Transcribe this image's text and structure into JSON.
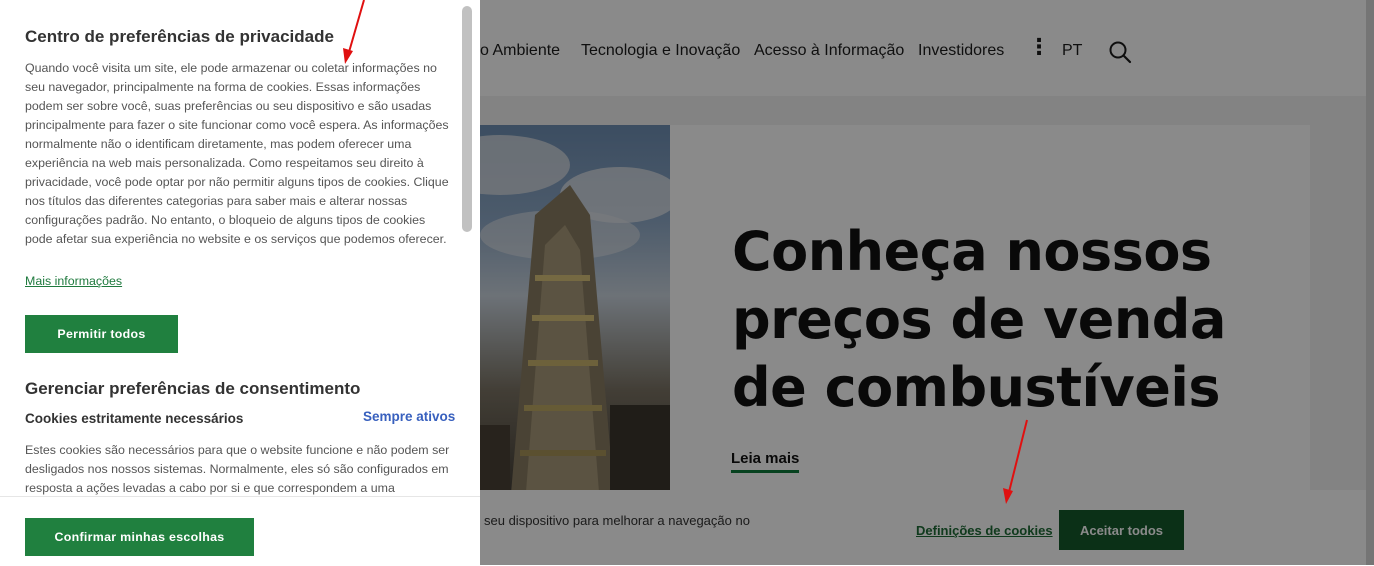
{
  "site": {
    "nav": {
      "items": [
        "o Ambiente",
        "Tecnologia e Inovação",
        "Acesso à Informação",
        "Investidores"
      ],
      "more_icon": "vertical-dots-icon",
      "language": "PT",
      "search_icon": "search-icon"
    },
    "hero": {
      "title": "Conheça nossos preços de venda de combustíveis",
      "link": "Leia mais"
    },
    "cookie_banner": {
      "text": "seu dispositivo para melhorar a navegação no",
      "settings_link": "Definições de cookies",
      "accept_all": "Aceitar todos"
    }
  },
  "privacy_panel": {
    "title": "Centro de preferências de privacidade",
    "description": "Quando você visita um site, ele pode armazenar ou coletar informações no seu navegador, principalmente na forma de cookies. Essas informações podem ser sobre você, suas preferências ou seu dispositivo e são usadas principalmente para fazer o site funcionar como você espera. As informações normalmente não o identificam diretamente, mas podem oferecer uma experiência na web mais personalizada. Como respeitamos seu direito à privacidade, você pode optar por não permitir alguns tipos de cookies. Clique nos títulos das diferentes categorias para saber mais e alterar nossas configurações padrão. No entanto, o bloqueio de alguns tipos de cookies pode afetar sua experiência no website e os serviços que podemos oferecer.",
    "more_info": "Mais informações",
    "allow_all": "Permitir todos",
    "manage_title": "Gerenciar preferências de consentimento",
    "category": {
      "title": "Cookies estritamente necessários",
      "status": "Sempre ativos",
      "description": "Estes cookies são necessários para que o website funcione e não podem ser desligados nos nossos sistemas. Normalmente, eles só são configurados em resposta a ações levadas a cabo por si e que correspondem a uma solicitação"
    },
    "confirm": "Confirmar minhas escolhas"
  },
  "colors": {
    "brand_green": "#20803f",
    "dark_green": "#155a2c",
    "link_blue": "#3860be",
    "annotation_red": "#e01010"
  }
}
